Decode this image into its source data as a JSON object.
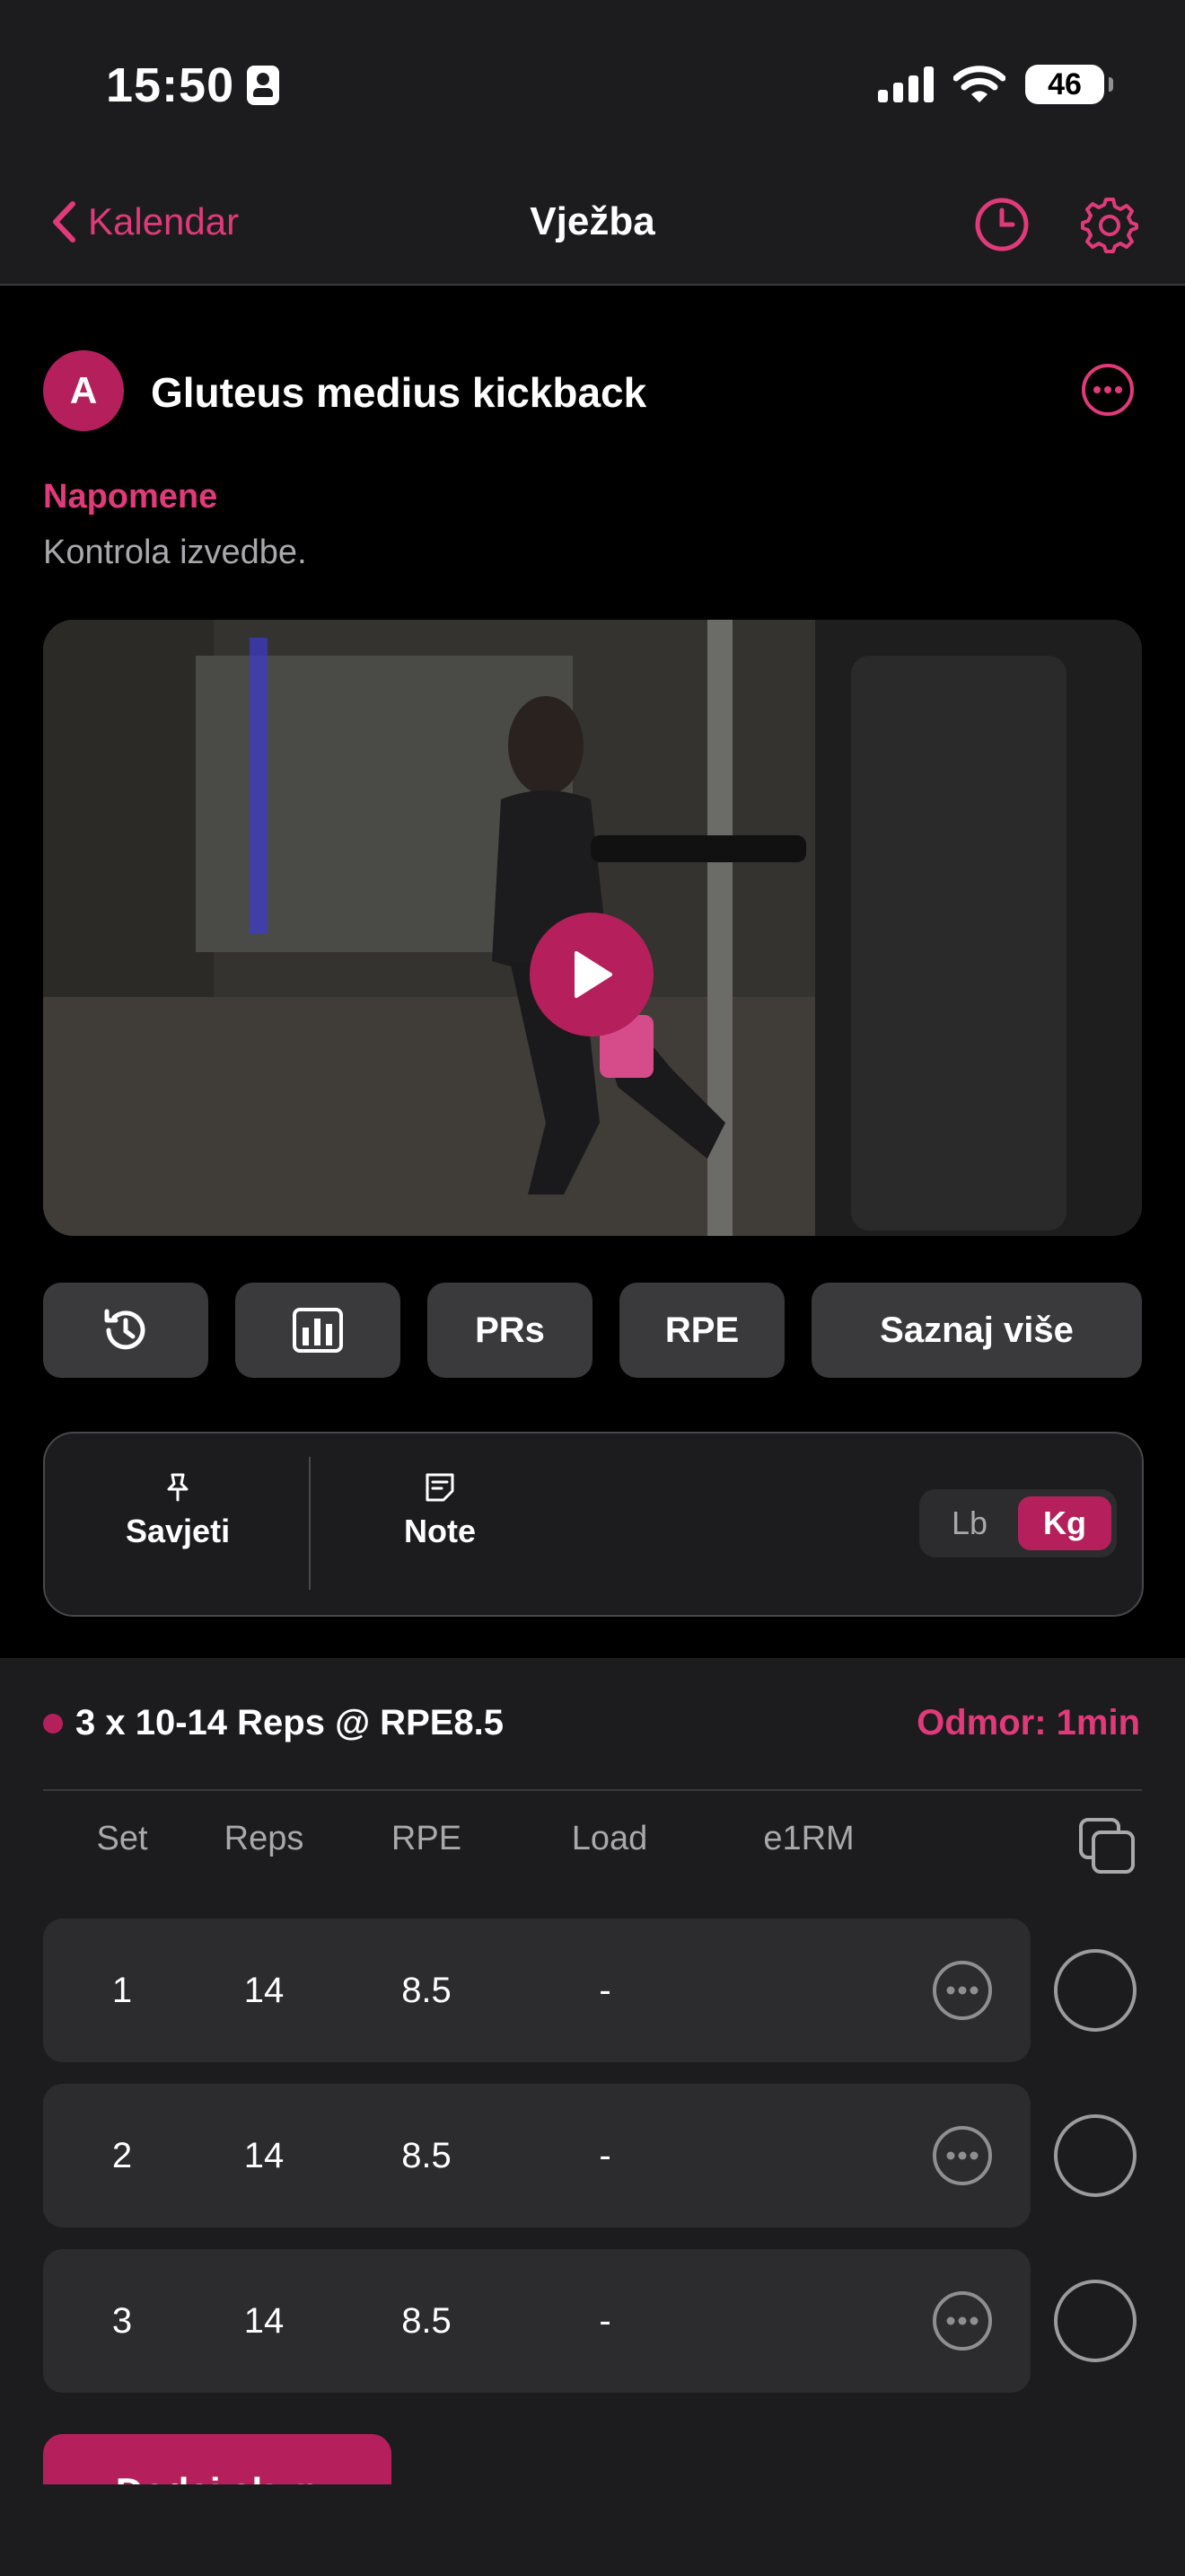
{
  "status_bar": {
    "time": "15:50",
    "battery": "46"
  },
  "nav": {
    "back_label": "Kalendar",
    "title": "Vježba"
  },
  "exercise": {
    "avatar_letter": "A",
    "name": "Gluteus medius kickback",
    "notes_label": "Napomene",
    "notes_text": "Kontrola izvedbe."
  },
  "actions": {
    "prs": "PRs",
    "rpe": "RPE",
    "learn_more": "Saznaj više"
  },
  "tips_card": {
    "tips_label": "Savjeti",
    "note_label": "Note",
    "unit_lb": "Lb",
    "unit_kg": "Kg",
    "selected_unit": "Kg"
  },
  "sets": {
    "scheme": "3 x 10-14 Reps @ RPE8.5",
    "rest": "Odmor: 1min",
    "columns": {
      "set": "Set",
      "reps": "Reps",
      "rpe": "RPE",
      "load": "Load",
      "e1rm": "e1RM"
    },
    "rows": [
      {
        "set": "1",
        "reps": "14",
        "rpe": "8.5",
        "load": "-"
      },
      {
        "set": "2",
        "reps": "14",
        "rpe": "8.5",
        "load": "-"
      },
      {
        "set": "3",
        "reps": "14",
        "rpe": "8.5",
        "load": "-"
      }
    ],
    "add_label": "Dodaj skup"
  },
  "colors": {
    "accent": "#e03a7a",
    "accent_dark": "#b5205c",
    "surface": "#1c1c1e",
    "row": "#2c2c2e"
  }
}
